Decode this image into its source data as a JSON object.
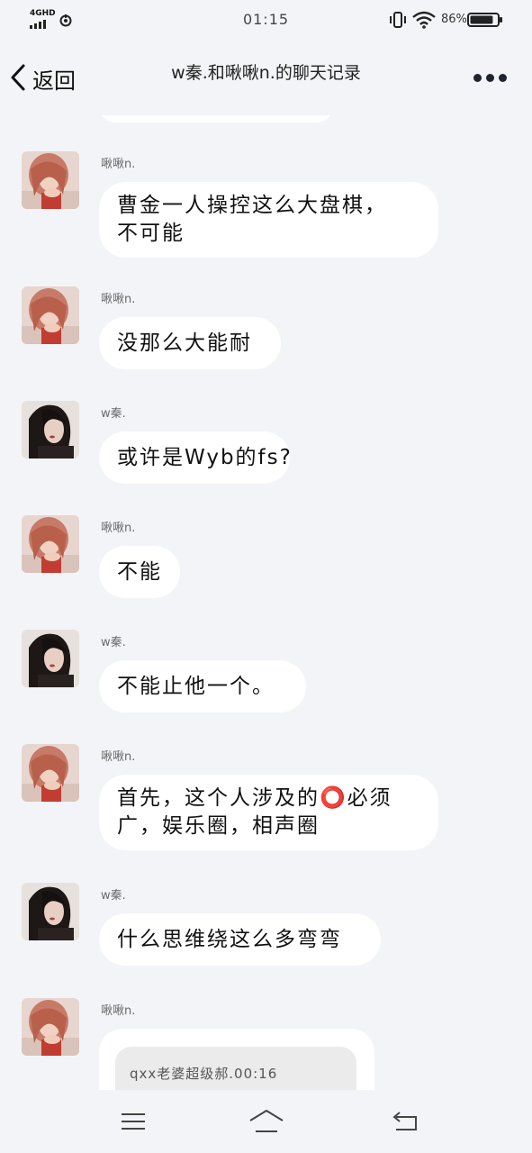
{
  "status_bar": {
    "network": "4GHD",
    "time": "01:15",
    "battery_percent": "86%",
    "battery_level": 0.86
  },
  "header": {
    "back_label": "返回",
    "title": "w秦.和啾啾n.的聊天记录",
    "more_icon": "more-dots-icon"
  },
  "messages": [
    {
      "sender": "啾啾n.",
      "avatar": "avatar-pink-hair",
      "lines": [
        "曹金一人操控这么大盘棋，",
        "不可能"
      ]
    },
    {
      "sender": "啾啾n.",
      "avatar": "avatar-pink-hair",
      "lines": [
        "没那么大能耐"
      ]
    },
    {
      "sender": "w秦.",
      "avatar": "avatar-dark-hair",
      "lines": [
        "或许是Wyb的fs?"
      ]
    },
    {
      "sender": "啾啾n.",
      "avatar": "avatar-pink-hair",
      "lines": [
        "不能"
      ]
    },
    {
      "sender": "w秦.",
      "avatar": "avatar-dark-hair",
      "lines": [
        "不能止他一个。"
      ]
    },
    {
      "sender": "啾啾n.",
      "avatar": "avatar-pink-hair",
      "lines": [
        "首先，这个人涉及的⭕必须",
        "广，娱乐圈，相声圈"
      ]
    },
    {
      "sender": "w秦.",
      "avatar": "avatar-dark-hair",
      "lines": [
        "什么思维绕这么多弯弯"
      ]
    },
    {
      "sender": "啾啾n.",
      "avatar": "avatar-pink-hair",
      "card_text": "qxx老婆超级郝.00:16"
    }
  ],
  "bottom_nav": {
    "menu_icon": "menu-icon",
    "home_icon": "home-icon",
    "back_icon": "return-icon"
  }
}
